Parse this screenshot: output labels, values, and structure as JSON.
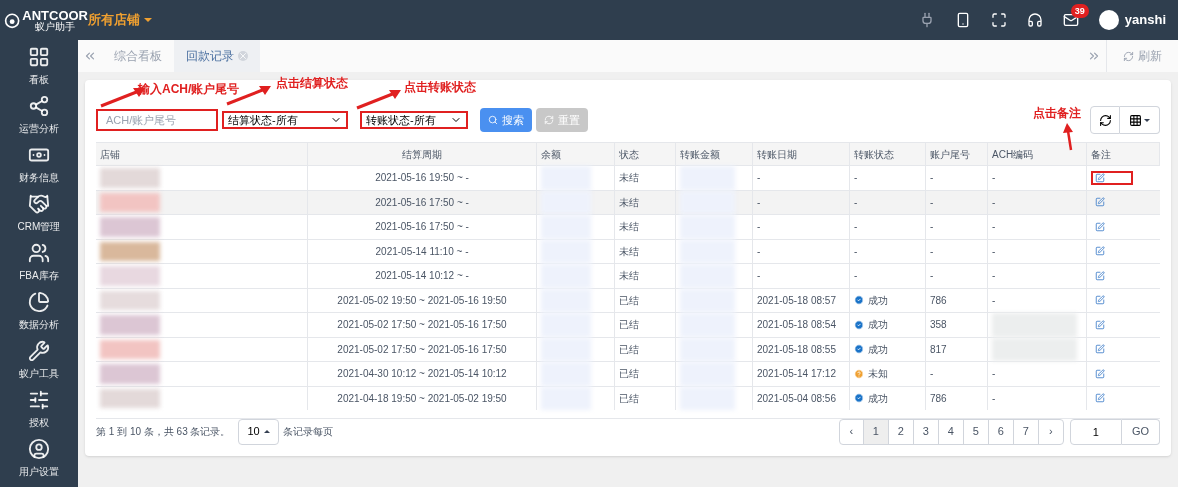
{
  "brand": {
    "name": "ANTCOOR",
    "subtitle": "蚁户助手"
  },
  "store_selector": {
    "label": "所有店铺"
  },
  "header": {
    "mail_count": "39",
    "username": "yanshi"
  },
  "sidebar": {
    "items": [
      {
        "label": "看板"
      },
      {
        "label": "运营分析"
      },
      {
        "label": "财务信息"
      },
      {
        "label": "CRM管理"
      },
      {
        "label": "FBA库存"
      },
      {
        "label": "数据分析"
      },
      {
        "label": "蚁户工具"
      },
      {
        "label": "授权"
      },
      {
        "label": "用户设置"
      }
    ]
  },
  "tabs": [
    {
      "label": "综合看板",
      "selected": false,
      "closable": false
    },
    {
      "label": "回款记录",
      "selected": true,
      "closable": true
    }
  ],
  "refresh_label": "刷新",
  "filters": {
    "search_placeholder": "ACH/账户尾号",
    "settle_select": "结算状态-所有",
    "transfer_select": "转账状态-所有",
    "search_button": "搜索",
    "reset_button": "重置"
  },
  "annotations": [
    {
      "text": "输入ACH/账户尾号"
    },
    {
      "text": "点击结算状态"
    },
    {
      "text": "点击转账状态"
    },
    {
      "text": "点击备注"
    }
  ],
  "table": {
    "columns": [
      "店铺",
      "结算周期",
      "余额",
      "状态",
      "转账金额",
      "转账日期",
      "转账状态",
      "账户尾号",
      "ACH编码",
      "备注"
    ],
    "rows": [
      {
        "hovered": false,
        "period": "2021-05-16 19:50 ~ -",
        "status": "未结",
        "date": "-",
        "transfer": {
          "kind": "none",
          "label": "-"
        },
        "account": "-",
        "ach": "-"
      },
      {
        "hovered": true,
        "period": "2021-05-16 17:50 ~ -",
        "status": "未结",
        "date": "-",
        "transfer": {
          "kind": "none",
          "label": "-"
        },
        "account": "-",
        "ach": "-"
      },
      {
        "hovered": false,
        "period": "2021-05-16 17:50 ~ -",
        "status": "未结",
        "date": "-",
        "transfer": {
          "kind": "none",
          "label": "-"
        },
        "account": "-",
        "ach": "-"
      },
      {
        "hovered": false,
        "period": "2021-05-14 11:10 ~ -",
        "status": "未结",
        "date": "-",
        "transfer": {
          "kind": "none",
          "label": "-"
        },
        "account": "-",
        "ach": "-"
      },
      {
        "hovered": false,
        "period": "2021-05-14 10:12 ~ -",
        "status": "未结",
        "date": "-",
        "transfer": {
          "kind": "none",
          "label": "-"
        },
        "account": "-",
        "ach": "-"
      },
      {
        "hovered": false,
        "period": "2021-05-02 19:50 ~ 2021-05-16 19:50",
        "status": "已结",
        "date": "2021-05-18 08:57",
        "transfer": {
          "kind": "success",
          "label": "成功"
        },
        "account": "786",
        "ach": "-"
      },
      {
        "hovered": false,
        "period": "2021-05-02 17:50 ~ 2021-05-16 17:50",
        "status": "已结",
        "date": "2021-05-18 08:54",
        "transfer": {
          "kind": "success",
          "label": "成功"
        },
        "account": "358"
      },
      {
        "hovered": false,
        "period": "2021-05-02 17:50 ~ 2021-05-16 17:50",
        "status": "已结",
        "date": "2021-05-18 08:55",
        "transfer": {
          "kind": "success",
          "label": "成功"
        },
        "account": "817"
      },
      {
        "hovered": false,
        "period": "2021-04-30 10:12 ~ 2021-05-14 10:12",
        "status": "已结",
        "date": "2021-05-14 17:12",
        "transfer": {
          "kind": "unknown",
          "label": "未知"
        },
        "account": "-",
        "ach": "-"
      },
      {
        "hovered": false,
        "period": "2021-04-18 19:50 ~ 2021-05-02 19:50",
        "status": "已结",
        "date": "2021-05-04 08:56",
        "transfer": {
          "kind": "success",
          "label": "成功"
        },
        "account": "786",
        "ach": "-"
      }
    ]
  },
  "footer": {
    "summary": "第 1 到 10 条，共 63 条记录。",
    "page_size": "10",
    "page_size_label": "条记录每页"
  },
  "pagination": {
    "prev": "‹",
    "next": "›",
    "pages": [
      {
        "label": "1",
        "selected": true
      },
      {
        "label": "2",
        "selected": false
      },
      {
        "label": "3",
        "selected": false
      },
      {
        "label": "4",
        "selected": false
      },
      {
        "label": "5",
        "selected": false
      },
      {
        "label": "6",
        "selected": false
      },
      {
        "label": "7",
        "selected": false
      }
    ],
    "goto_value": "1",
    "goto_button": "GO"
  }
}
